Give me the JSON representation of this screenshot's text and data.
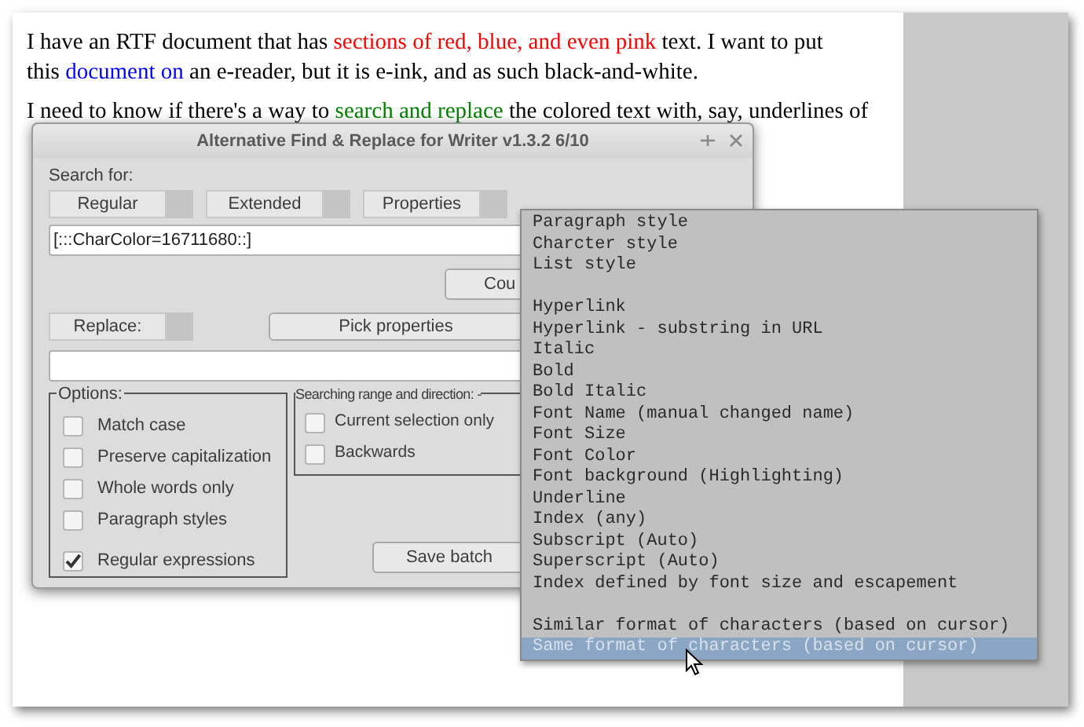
{
  "document": {
    "paragraphs": [
      {
        "segments": [
          {
            "text": "I have an RTF document that has ",
            "color": "#000000"
          },
          {
            "text": "sections of red, blue, and even pink",
            "color": "#ff0000"
          },
          {
            "text": " text. I want to put this ",
            "color": "#000000"
          },
          {
            "text": "document on",
            "color": "#0000ff"
          },
          {
            "text": " an e-reader, but it is e-ink, and as such black-and-white.",
            "color": "#000000"
          }
        ]
      },
      {
        "segments": [
          {
            "text": "I need to know if there's a way to ",
            "color": "#000000"
          },
          {
            "text": "search and replace",
            "color": "#008000"
          },
          {
            "text": " the colored text with, say, underlines of",
            "color": "#000000"
          }
        ]
      }
    ]
  },
  "dialog": {
    "title": "Alternative Find & Replace for Writer  v1.3.2  6/10",
    "search_label": "Search for:",
    "modes": [
      "Regular",
      "Extended",
      "Properties"
    ],
    "search_value": "[:::CharColor=16711680::]",
    "count_button": "Cou",
    "replace_label": "Replace:",
    "pick_button": "Pick properties",
    "options_title": "Options:",
    "options": [
      {
        "label": "Match case",
        "checked": false
      },
      {
        "label": "Preserve capitalization",
        "checked": false
      },
      {
        "label": "Whole words only",
        "checked": false
      },
      {
        "label": "Paragraph styles",
        "checked": false
      },
      {
        "label": "Regular expressions",
        "checked": true
      }
    ],
    "range_title": "Searching range and direction: -",
    "range_options": [
      {
        "label": "Current selection only",
        "checked": false
      },
      {
        "label": "Backwards",
        "checked": false
      }
    ],
    "save_button": "Save batch"
  },
  "menu": {
    "items": [
      {
        "kind": "item",
        "label": "Paragraph style",
        "selected": false
      },
      {
        "kind": "item",
        "label": "Charcter style",
        "selected": false
      },
      {
        "kind": "item",
        "label": "List style",
        "selected": false
      },
      {
        "kind": "blank"
      },
      {
        "kind": "item",
        "label": "Hyperlink",
        "selected": false
      },
      {
        "kind": "item",
        "label": "Hyperlink - substring in URL",
        "selected": false
      },
      {
        "kind": "item",
        "label": "Italic",
        "selected": false
      },
      {
        "kind": "item",
        "label": "Bold",
        "selected": false
      },
      {
        "kind": "item",
        "label": "Bold Italic",
        "selected": false
      },
      {
        "kind": "item",
        "label": "Font Name (manual changed name)",
        "selected": false
      },
      {
        "kind": "item",
        "label": "Font Size",
        "selected": false
      },
      {
        "kind": "item",
        "label": "Font Color",
        "selected": false
      },
      {
        "kind": "item",
        "label": "Font background (Highlighting)",
        "selected": false
      },
      {
        "kind": "item",
        "label": "Underline",
        "selected": false
      },
      {
        "kind": "item",
        "label": "Index (any)",
        "selected": false
      },
      {
        "kind": "item",
        "label": "Subscript (Auto)",
        "selected": false
      },
      {
        "kind": "item",
        "label": "Superscript (Auto)",
        "selected": false
      },
      {
        "kind": "item",
        "label": "Index defined by font size and escapement",
        "selected": false
      },
      {
        "kind": "blank"
      },
      {
        "kind": "item",
        "label": "Similar format of characters (based on cursor)",
        "selected": false
      },
      {
        "kind": "item",
        "label": "Same format of characters (based on cursor)",
        "selected": true
      }
    ]
  }
}
